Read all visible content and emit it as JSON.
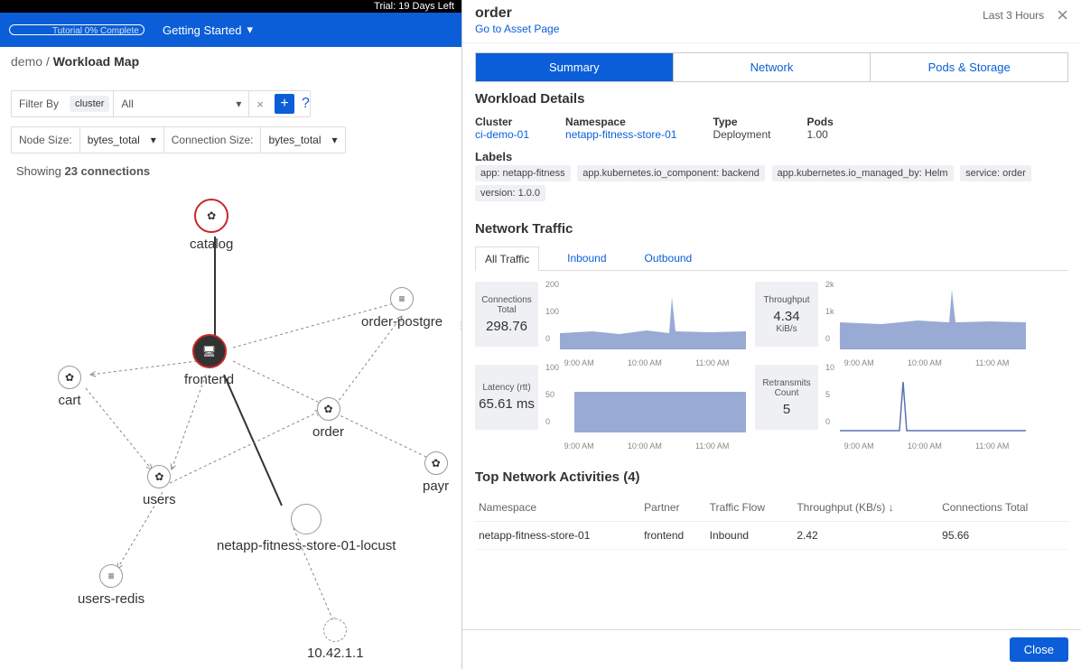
{
  "trial_text": "Trial: 19 Days Left",
  "tutorial": {
    "label": "Tutorial 0% Complete",
    "getting_started": "Getting Started"
  },
  "breadcrumb": {
    "root": "demo",
    "current": "Workload Map"
  },
  "filter": {
    "label": "Filter By",
    "chip": "cluster",
    "value": "All"
  },
  "sizes": {
    "node_label": "Node Size:",
    "node_value": "bytes_total",
    "conn_label": "Connection Size:",
    "conn_value": "bytes_total"
  },
  "showing": {
    "prefix": "Showing ",
    "count": "23 connections"
  },
  "nodes": {
    "catalog": "catalog",
    "frontend": "frontend",
    "cart": "cart",
    "order": "order",
    "users": "users",
    "order_postgres": "order-postgre",
    "payr": "payr",
    "locust": "netapp-fitness-store-01-locust",
    "users_redis": "users-redis",
    "ip": "10.42.1.1"
  },
  "panel": {
    "title": "order",
    "asset_link": "Go to Asset Page",
    "time": "Last 3 Hours",
    "tabs": {
      "summary": "Summary",
      "network": "Network",
      "pods": "Pods & Storage"
    },
    "workload_details_title": "Workload Details",
    "details": {
      "cluster_label": "Cluster",
      "cluster_value": "ci-demo-01",
      "namespace_label": "Namespace",
      "namespace_value": "netapp-fitness-store-01",
      "type_label": "Type",
      "type_value": "Deployment",
      "pods_label": "Pods",
      "pods_value": "1.00"
    },
    "labels_label": "Labels",
    "labels": [
      "app: netapp-fitness",
      "app.kubernetes.io_component: backend",
      "app.kubernetes.io_managed_by: Helm",
      "service: order",
      "version: 1.0.0"
    ],
    "network_traffic_title": "Network Traffic",
    "traffic_tabs": {
      "all": "All Traffic",
      "inbound": "Inbound",
      "outbound": "Outbound"
    },
    "metrics": {
      "conn_label": "Connections Total",
      "conn_value": "298.76",
      "thr_label": "Throughput",
      "thr_value": "4.34",
      "thr_unit": "KiB/s",
      "lat_label": "Latency (rtt)",
      "lat_value": "65.61 ms",
      "ret_label": "Retransmits Count",
      "ret_value": "5"
    },
    "chart_ticks": [
      "9:00 AM",
      "10:00 AM",
      "11:00 AM"
    ],
    "top_activities_title": "Top Network Activities (4)",
    "activities_cols": {
      "ns": "Namespace",
      "partner": "Partner",
      "flow": "Traffic Flow",
      "thr": "Throughput (KB/s) ↓",
      "conn": "Connections Total"
    },
    "activities": [
      {
        "ns": "netapp-fitness-store-01",
        "partner": "frontend",
        "flow": "Inbound",
        "thr": "2.42",
        "conn": "95.66"
      }
    ],
    "close_btn": "Close"
  },
  "chart_data": [
    {
      "type": "area",
      "title": "Connections Total",
      "ylim": [
        0,
        200
      ],
      "x_ticks": [
        "9:00 AM",
        "10:00 AM",
        "11:00 AM"
      ],
      "baseline": 55,
      "spike_at": 0.62,
      "spike_value": 170
    },
    {
      "type": "area",
      "title": "Throughput",
      "ylim": [
        0,
        2000
      ],
      "x_ticks": [
        "9:00 AM",
        "10:00 AM",
        "11:00 AM"
      ],
      "baseline": 850,
      "spike_at": 0.62,
      "spike_value": 2000
    },
    {
      "type": "area",
      "title": "Latency (rtt)",
      "ylim": [
        0,
        100
      ],
      "x_ticks": [
        "9:00 AM",
        "10:00 AM",
        "11:00 AM"
      ],
      "baseline": 65,
      "start_at": 0.08
    },
    {
      "type": "line",
      "title": "Retransmits Count",
      "ylim": [
        0,
        10
      ],
      "x_ticks": [
        "9:00 AM",
        "10:00 AM",
        "11:00 AM"
      ],
      "spike_at": 0.32,
      "spike_value": 8
    }
  ]
}
